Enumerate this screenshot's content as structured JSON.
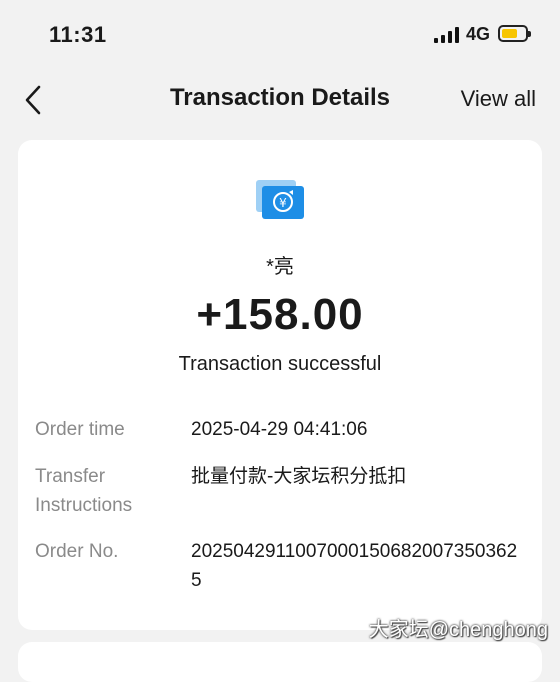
{
  "status_bar": {
    "time": "11:31",
    "network": "4G"
  },
  "nav": {
    "title": "Transaction Details",
    "view_all": "View all"
  },
  "transaction": {
    "payee": "*亮",
    "amount": "+158.00",
    "status": "Transaction successful"
  },
  "details": [
    {
      "label": "Order time",
      "value": "2025-04-29 04:41:06"
    },
    {
      "label": "Transfer Instructions",
      "value": "批量付款-大家坛积分抵扣"
    },
    {
      "label": "Order No.",
      "value": "2025042911007000150682007350362 5"
    }
  ],
  "watermark": "大家坛@chenghong",
  "colors": {
    "accent": "#1e8ee6",
    "battery": "#f7c500"
  }
}
